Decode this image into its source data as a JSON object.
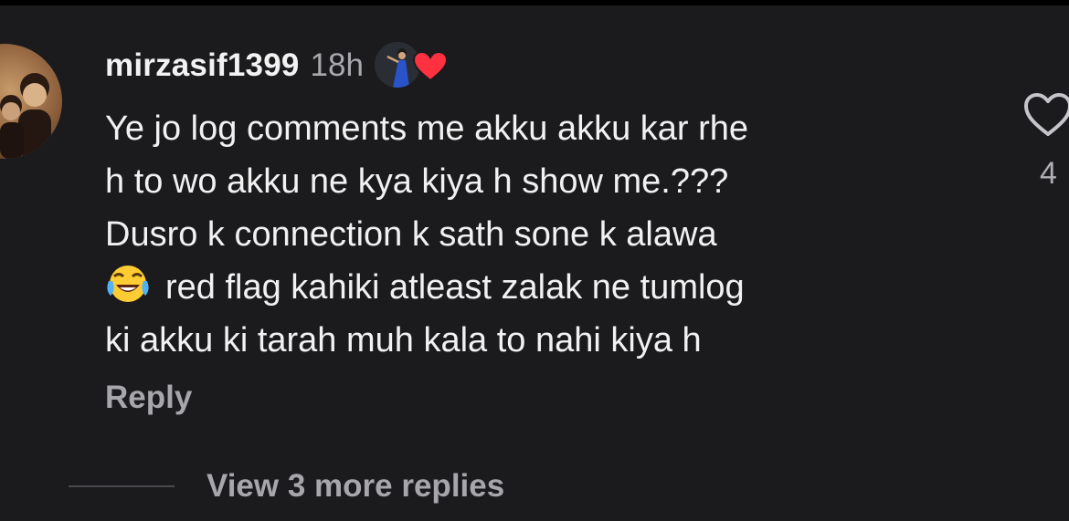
{
  "comment": {
    "username": "mirzasif1399",
    "time": "18h",
    "avatar_icon": "user-avatar-photo",
    "author_liked_icon": "author-avatar-with-heart",
    "lines": [
      "Ye jo log comments me akku akku kar rhe",
      "h to wo akku ne kya kiya h show me.???",
      "Dusro k connection k sath sone k alawa",
      "red flag kahiki atleast zalak ne tumlog",
      "ki akku ki tarah muh kala to nahi kiya h"
    ],
    "emoji_icon": "face-with-tears-of-joy-icon",
    "reply_label": "Reply",
    "like_count": "4",
    "like_icon": "heart-outline-icon"
  },
  "replies": {
    "view_more_label": "View 3 more replies"
  },
  "colors": {
    "background": "#1b1b1d",
    "text_primary": "#f1f1f1",
    "text_secondary": "#a7a7ab",
    "heart_red": "#ff3040"
  }
}
